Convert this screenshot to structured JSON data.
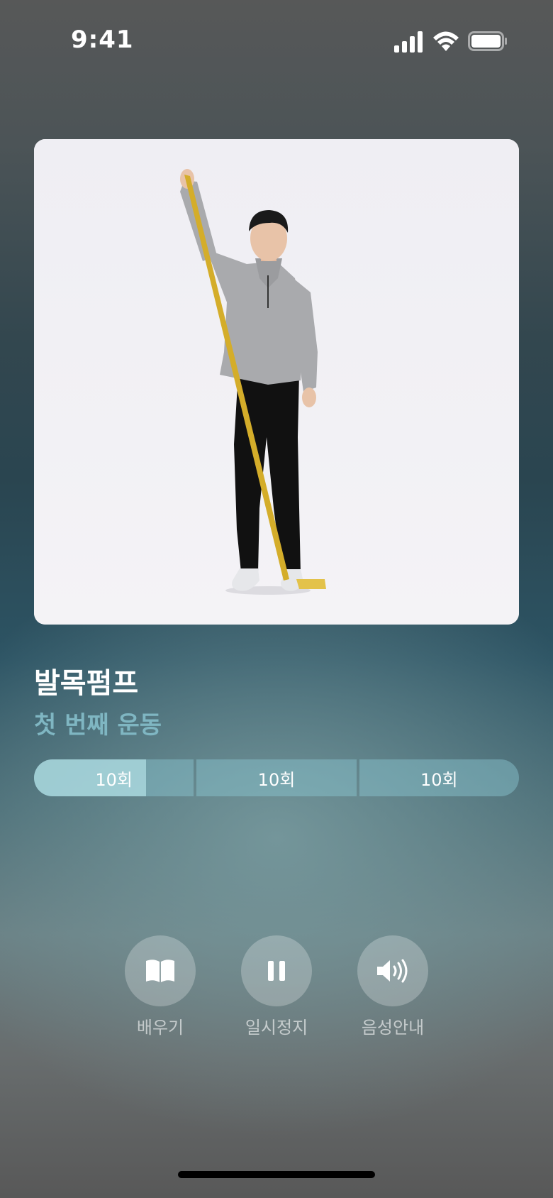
{
  "status_bar": {
    "time": "9:41",
    "icons": [
      "signal-icon",
      "wifi-icon",
      "battery-icon"
    ]
  },
  "exercise": {
    "title": "발목펌프",
    "subtitle": "첫 번째 운동",
    "image": "person-resistance-band-exercise"
  },
  "sets": [
    {
      "label": "10회",
      "progress": 0.7
    },
    {
      "label": "10회",
      "progress": 0
    },
    {
      "label": "10회",
      "progress": 0
    }
  ],
  "controls": [
    {
      "label": "배우기",
      "icon": "book-icon"
    },
    {
      "label": "일시정지",
      "icon": "pause-icon"
    },
    {
      "label": "음성안내",
      "icon": "speaker-icon"
    }
  ],
  "colors": {
    "subtitle": "#7fb6c2",
    "set_track": "#8cc8d2",
    "set_fill": "#afdce1"
  }
}
